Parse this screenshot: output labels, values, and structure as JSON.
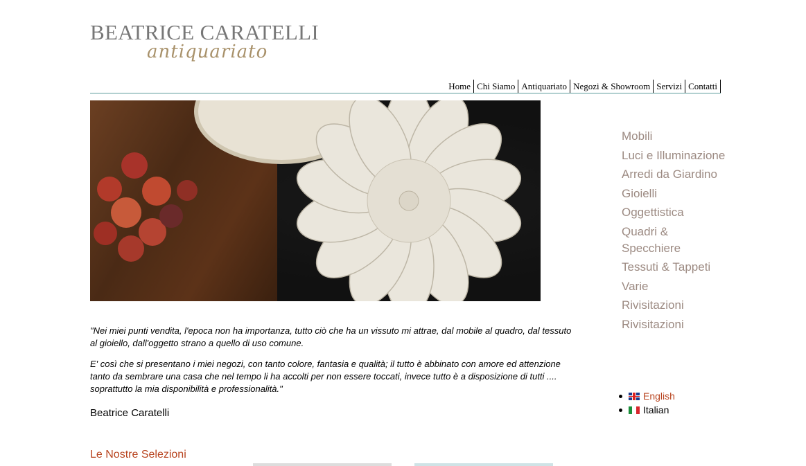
{
  "logo": {
    "main": "BEATRICE CARATELLI",
    "sub": "antiquariato"
  },
  "nav": [
    "Home",
    "Chi Siamo",
    "Antiquariato",
    "Negozi & Showroom",
    "Servizi",
    "Contatti"
  ],
  "quote": {
    "p1": "\"Nei miei punti vendita, l'epoca non ha importanza, tutto ciò che ha un vissuto mi attrae, dal mobile al quadro, dal tessuto al gioiello, dall'oggetto strano a quello di uso comune.",
    "p2": "E' così che si presentano i miei negozi, con tanto colore, fantasia e qualità; il tutto è abbinato con amore ed attenzione tanto da sembrare una casa che nel tempo li ha accolti per non essere toccati, invece tutto è a disposizione di tutti .... soprattutto la mia disponibilità e professionalità.\""
  },
  "signature": "Beatrice Caratelli",
  "selections_title": "Le Nostre Selezioni",
  "categories": [
    "Mobili",
    "Luci e Illuminazione",
    "Arredi da Giardino",
    "Gioielli",
    "Oggettistica",
    "Quadri & Specchiere",
    "Tessuti & Tappeti",
    "Varie",
    "Rivisitazioni",
    "Rivisitazioni"
  ],
  "languages": [
    {
      "label": "English",
      "flag": "uk-flag-icon"
    },
    {
      "label": "Italian",
      "flag": "italy-flag-icon"
    }
  ],
  "colors": {
    "accent": "#b8441f",
    "category": "#9c8a82",
    "logo": "#777777",
    "logo_sub": "#a8916a",
    "rule": "#5a9a9a"
  }
}
